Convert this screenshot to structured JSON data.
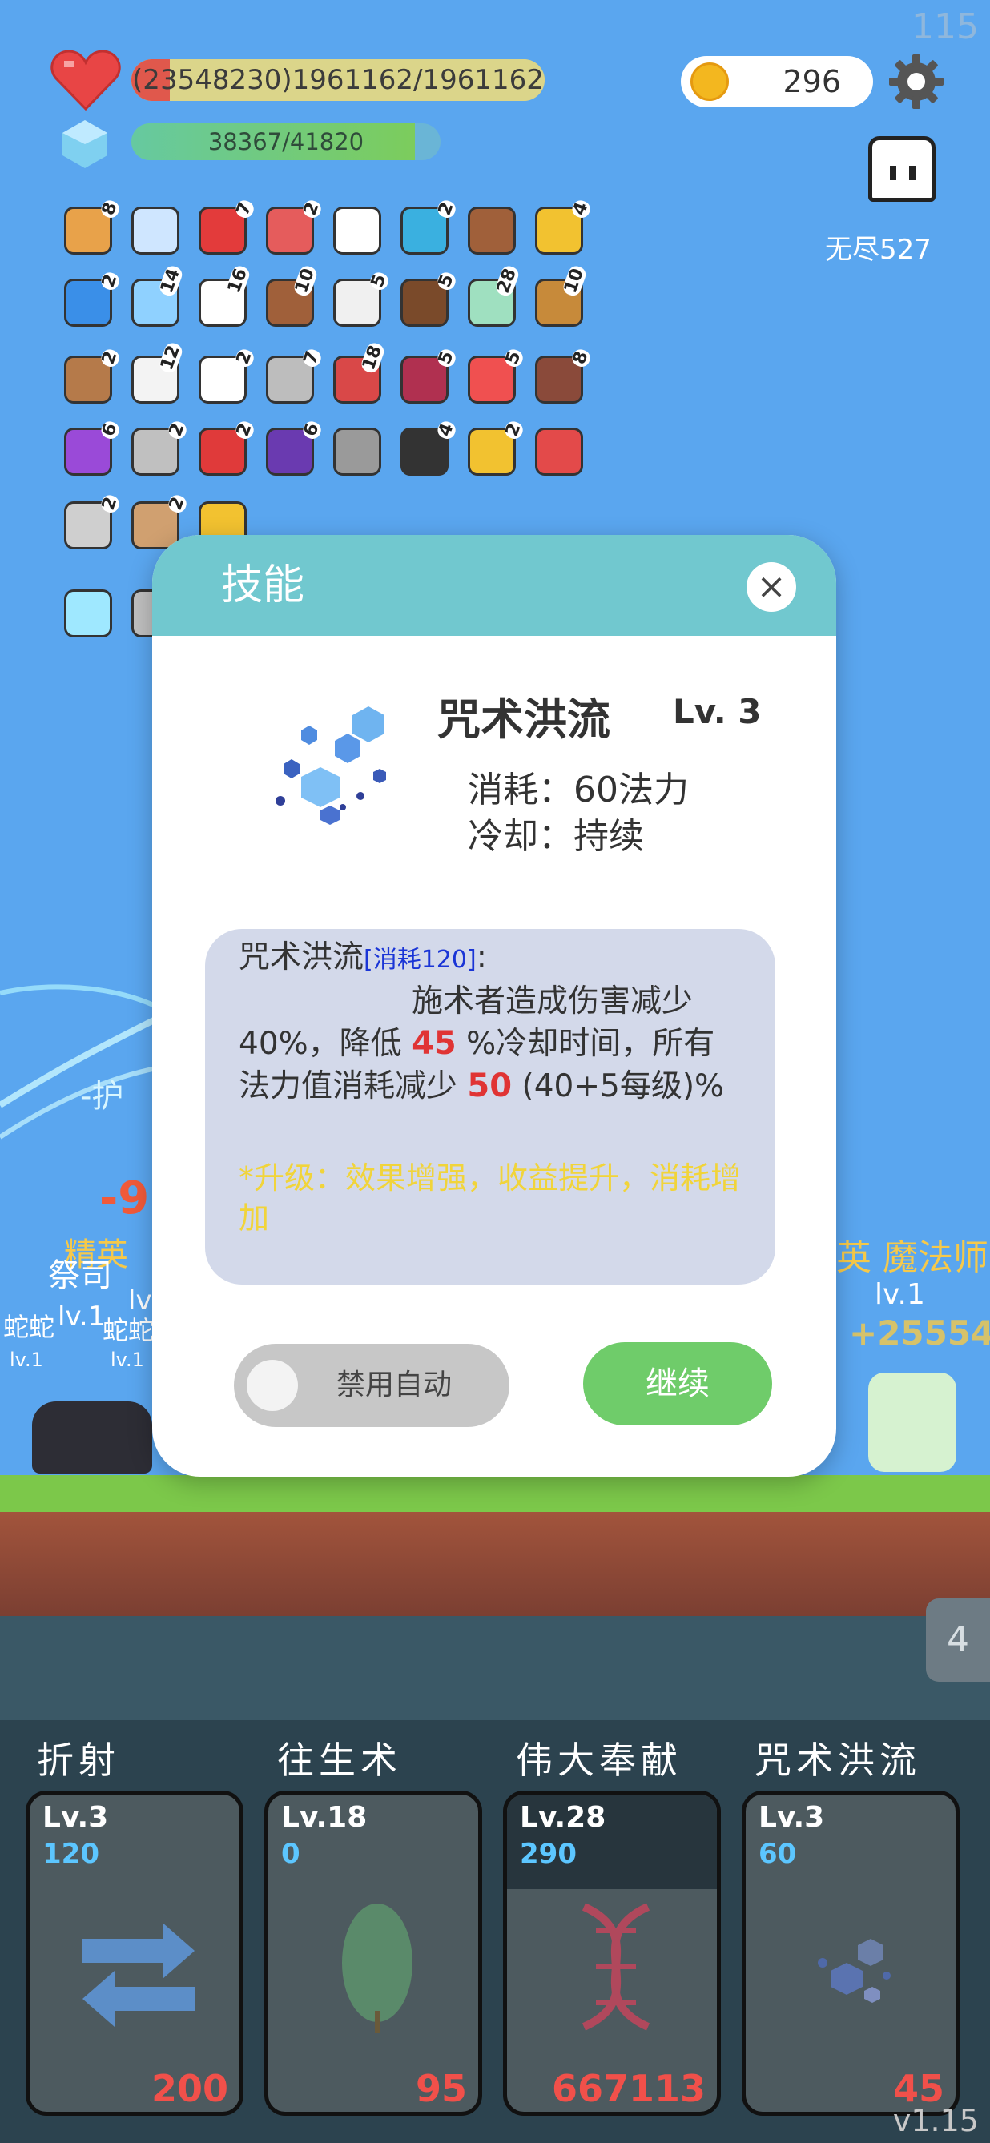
{
  "status": {
    "fps": "115",
    "version": "v1.15"
  },
  "hud": {
    "hp_text": "(23548230)1961162/1961162",
    "hp_fraction": 1.0,
    "mp_text": "38367/41820",
    "mp_fraction": 0.917,
    "coins": "296",
    "endless_label": "无尽527"
  },
  "items": [
    {
      "icon": "book-icon",
      "count": "8",
      "color": "#e8a24a"
    },
    {
      "icon": "magnifier-icon",
      "count": "",
      "color": "#cfe6ff"
    },
    {
      "icon": "strawberry-icon",
      "count": "7",
      "color": "#e33b3b"
    },
    {
      "icon": "watermelon-icon",
      "count": "2",
      "color": "#e55c5c"
    },
    {
      "icon": "ring-chain-icon",
      "count": "",
      "color": "#ffffff"
    },
    {
      "icon": "fish-icon",
      "count": "2",
      "color": "#3ab0e0"
    },
    {
      "icon": "treasure-chest-icon",
      "count": "",
      "color": "#a0603a"
    },
    {
      "icon": "magic-wand-icon",
      "count": "4",
      "color": "#f2c230"
    },
    {
      "icon": "blue-gem-icon",
      "count": "2",
      "color": "#3a8fe8"
    },
    {
      "icon": "bubble-icon",
      "count": "14",
      "color": "#8fd1ff"
    },
    {
      "icon": "cloud-icon",
      "count": "16",
      "color": "#ffffff"
    },
    {
      "icon": "drink-icon",
      "count": "10",
      "color": "#a0603a"
    },
    {
      "icon": "lightbulb-icon",
      "count": "5",
      "color": "#f0f0f0"
    },
    {
      "icon": "coconut-icon",
      "count": "5",
      "color": "#7a4a2a"
    },
    {
      "icon": "tree-icon",
      "count": "28",
      "color": "#9fe0c0"
    },
    {
      "icon": "bow-icon",
      "count": "10",
      "color": "#c78a3a"
    },
    {
      "icon": "shield-icon",
      "count": "2",
      "color": "#b57a4a"
    },
    {
      "icon": "envelope-icon",
      "count": "12",
      "color": "#f3f3f3"
    },
    {
      "icon": "dice-icon",
      "count": "2",
      "color": "#ffffff"
    },
    {
      "icon": "axe-icon",
      "count": "7",
      "color": "#bdbdbd"
    },
    {
      "icon": "red-shield-icon",
      "count": "18",
      "color": "#d94848"
    },
    {
      "icon": "jam-jar-icon",
      "count": "5",
      "color": "#b03050"
    },
    {
      "icon": "pill-icon",
      "count": "5",
      "color": "#f05050"
    },
    {
      "icon": "door-icon",
      "count": "8",
      "color": "#8a4a3a"
    },
    {
      "icon": "purple-potion-icon",
      "count": "6",
      "color": "#9a4ad8"
    },
    {
      "icon": "sword-icon",
      "count": "2",
      "color": "#c0c0c0"
    },
    {
      "icon": "apple-icon",
      "count": "2",
      "color": "#e03a3a"
    },
    {
      "icon": "purple-hat-icon",
      "count": "6",
      "color": "#6a3ab0"
    },
    {
      "icon": "spiked-mace-icon",
      "count": "",
      "color": "#9a9a9a"
    },
    {
      "icon": "bomb-icon",
      "count": "4",
      "color": "#333333"
    },
    {
      "icon": "gold-ring-icon",
      "count": "2",
      "color": "#f2c230"
    },
    {
      "icon": "hearts-icon",
      "count": "",
      "color": "#e34a4a"
    },
    {
      "icon": "hook-icon",
      "count": "2",
      "color": "#cfcfcf"
    },
    {
      "icon": "meteor-icon",
      "count": "2",
      "color": "#d0a070"
    },
    {
      "icon": "sunflower-icon",
      "count": "",
      "color": "#f2c230"
    },
    {
      "icon": "glowing-tile-icon",
      "count": "",
      "color": "#9fe8ff"
    },
    {
      "icon": "striped-tile-icon",
      "count": "",
      "color": "#c0c0c0"
    }
  ],
  "scene": {
    "damage_text": "-9",
    "left_name_a": "精英",
    "left_name_b": "祭司",
    "snake_a": "蛇蛇",
    "snake_b": "蛇蛇",
    "lv_a": "lv.1",
    "lv_b": "lv.1",
    "lv_small_a": "lv.1",
    "lv_small_b": "lv.1",
    "right_name": "英 魔法师",
    "right_lv": "lv.1",
    "right_num": "+25554",
    "wave_number": "4",
    "floor_text": "-护"
  },
  "modal": {
    "title": "技能",
    "close_symbol": "×",
    "skill_name": "咒术洪流",
    "skill_level": "Lv. 3",
    "cost_line": "消耗：60法力",
    "cooldown_line": "冷却：持续",
    "desc": {
      "name": "咒术洪流",
      "cost_bracket": "[消耗120]",
      "colon": ":",
      "part1": "施术者造成伤害减少40%，降低",
      "value1": "45",
      "part2": "%冷却时间，所有法力值消耗减少",
      "value2": "50",
      "part3": "(40+5每级)%"
    },
    "upgrade_note": "*升级：效果增强，收益提升，消耗增加",
    "auto_toggle_label": "禁用自动",
    "continue_label": "继续"
  },
  "skills": [
    {
      "title": "折射",
      "level": "Lv.3",
      "mana": "120",
      "number": "200",
      "icon": "arrows-swap-icon"
    },
    {
      "title": "往生术",
      "level": "Lv.18",
      "mana": "0",
      "number": "95",
      "icon": "leaf-icon"
    },
    {
      "title": "伟大奉献",
      "level": "Lv.28",
      "mana": "290",
      "number": "667113",
      "icon": "dna-icon"
    },
    {
      "title": "咒术洪流",
      "level": "Lv.3",
      "mana": "60",
      "number": "45",
      "icon": "hexagons-icon"
    }
  ]
}
